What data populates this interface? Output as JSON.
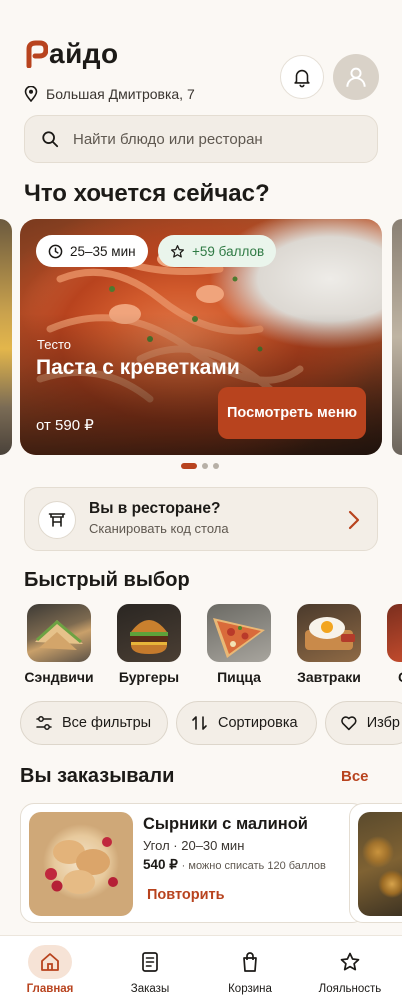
{
  "brand": {
    "name": "айдо",
    "accent": "#b8431e"
  },
  "location": {
    "icon": "location-pin-icon",
    "address": "Большая Дмитровка, 7"
  },
  "header": {
    "bell_icon": "bell-icon",
    "avatar_icon": "user-icon"
  },
  "search": {
    "placeholder": "Найти блюдо или ресторан",
    "icon": "search-icon"
  },
  "featured": {
    "heading": "Что хочется сейчас?",
    "card": {
      "time": "25–35 мин",
      "points": "+59 баллов",
      "category": "Тесто",
      "title": "Паста с креветками",
      "price": "от 590 ₽",
      "button": "Посмотреть меню"
    },
    "pages": 3,
    "active_page": 1
  },
  "restaurant_prompt": {
    "title": "Вы в ресторане?",
    "subtitle": "Сканировать код стола",
    "icon": "table-icon",
    "arrow_icon": "chevron-right-icon"
  },
  "quick": {
    "heading": "Быстрый выбор",
    "items": [
      {
        "label": "Сэндвичи",
        "image": "sandwich"
      },
      {
        "label": "Бургеры",
        "image": "burger"
      },
      {
        "label": "Пицца",
        "image": "pizza"
      },
      {
        "label": "Завтраки",
        "image": "breakfast"
      },
      {
        "label": "С",
        "image": "partial"
      }
    ]
  },
  "filters": [
    {
      "label": "Все фильтры",
      "icon": "sliders-icon"
    },
    {
      "label": "Сортировка",
      "icon": "sort-icon"
    },
    {
      "label": "Избр",
      "icon": "heart-icon"
    }
  ],
  "orders": {
    "heading": "Вы заказывали",
    "all_link": "Все",
    "items": [
      {
        "title": "Сырники с малиной",
        "place": "Угол",
        "time": "20–30 мин",
        "price": "540 ₽",
        "note": "можно списать 120 баллов",
        "action": "Повторить"
      }
    ]
  },
  "nav": [
    {
      "label": "Главная",
      "icon": "home-icon",
      "active": true
    },
    {
      "label": "Заказы",
      "icon": "receipt-icon",
      "active": false
    },
    {
      "label": "Корзина",
      "icon": "bag-icon",
      "active": false
    },
    {
      "label": "Лояльность",
      "icon": "star-icon",
      "active": false
    }
  ]
}
